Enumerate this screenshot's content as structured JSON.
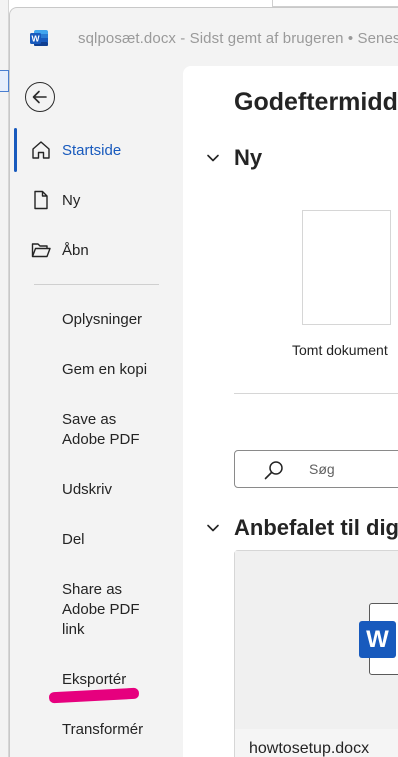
{
  "window": {
    "title": "sqlposæt.docx  -  Sidst gemt af brugeren  •  Senest"
  },
  "sidebar": {
    "main_items": [
      {
        "label": "Startside",
        "icon": "home-icon",
        "active": true
      },
      {
        "label": "Ny",
        "icon": "new-document-icon",
        "active": false
      },
      {
        "label": "Åbn",
        "icon": "open-folder-icon",
        "active": false
      }
    ],
    "sub_items": [
      {
        "label": "Oplysninger"
      },
      {
        "label": "Gem en kopi"
      },
      {
        "label": "Save as Adobe PDF"
      },
      {
        "label": "Udskriv"
      },
      {
        "label": "Del"
      },
      {
        "label": "Share as Adobe PDF link"
      },
      {
        "label": "Eksportér"
      },
      {
        "label": "Transformér"
      }
    ],
    "highlight_color": "#e6007e"
  },
  "main": {
    "greeting": "Godeftermiddag",
    "new_section": {
      "title": "Ny",
      "blank_document_label": "Tomt dokument"
    },
    "search": {
      "placeholder": "Søg"
    },
    "recommended_section": {
      "title": "Anbefalet til dig",
      "items": [
        {
          "name": "howtosetup.docx"
        }
      ]
    }
  },
  "colors": {
    "accent": "#185abd",
    "sidebar_bg": "#f3f3f3",
    "content_bg": "#ffffff"
  }
}
